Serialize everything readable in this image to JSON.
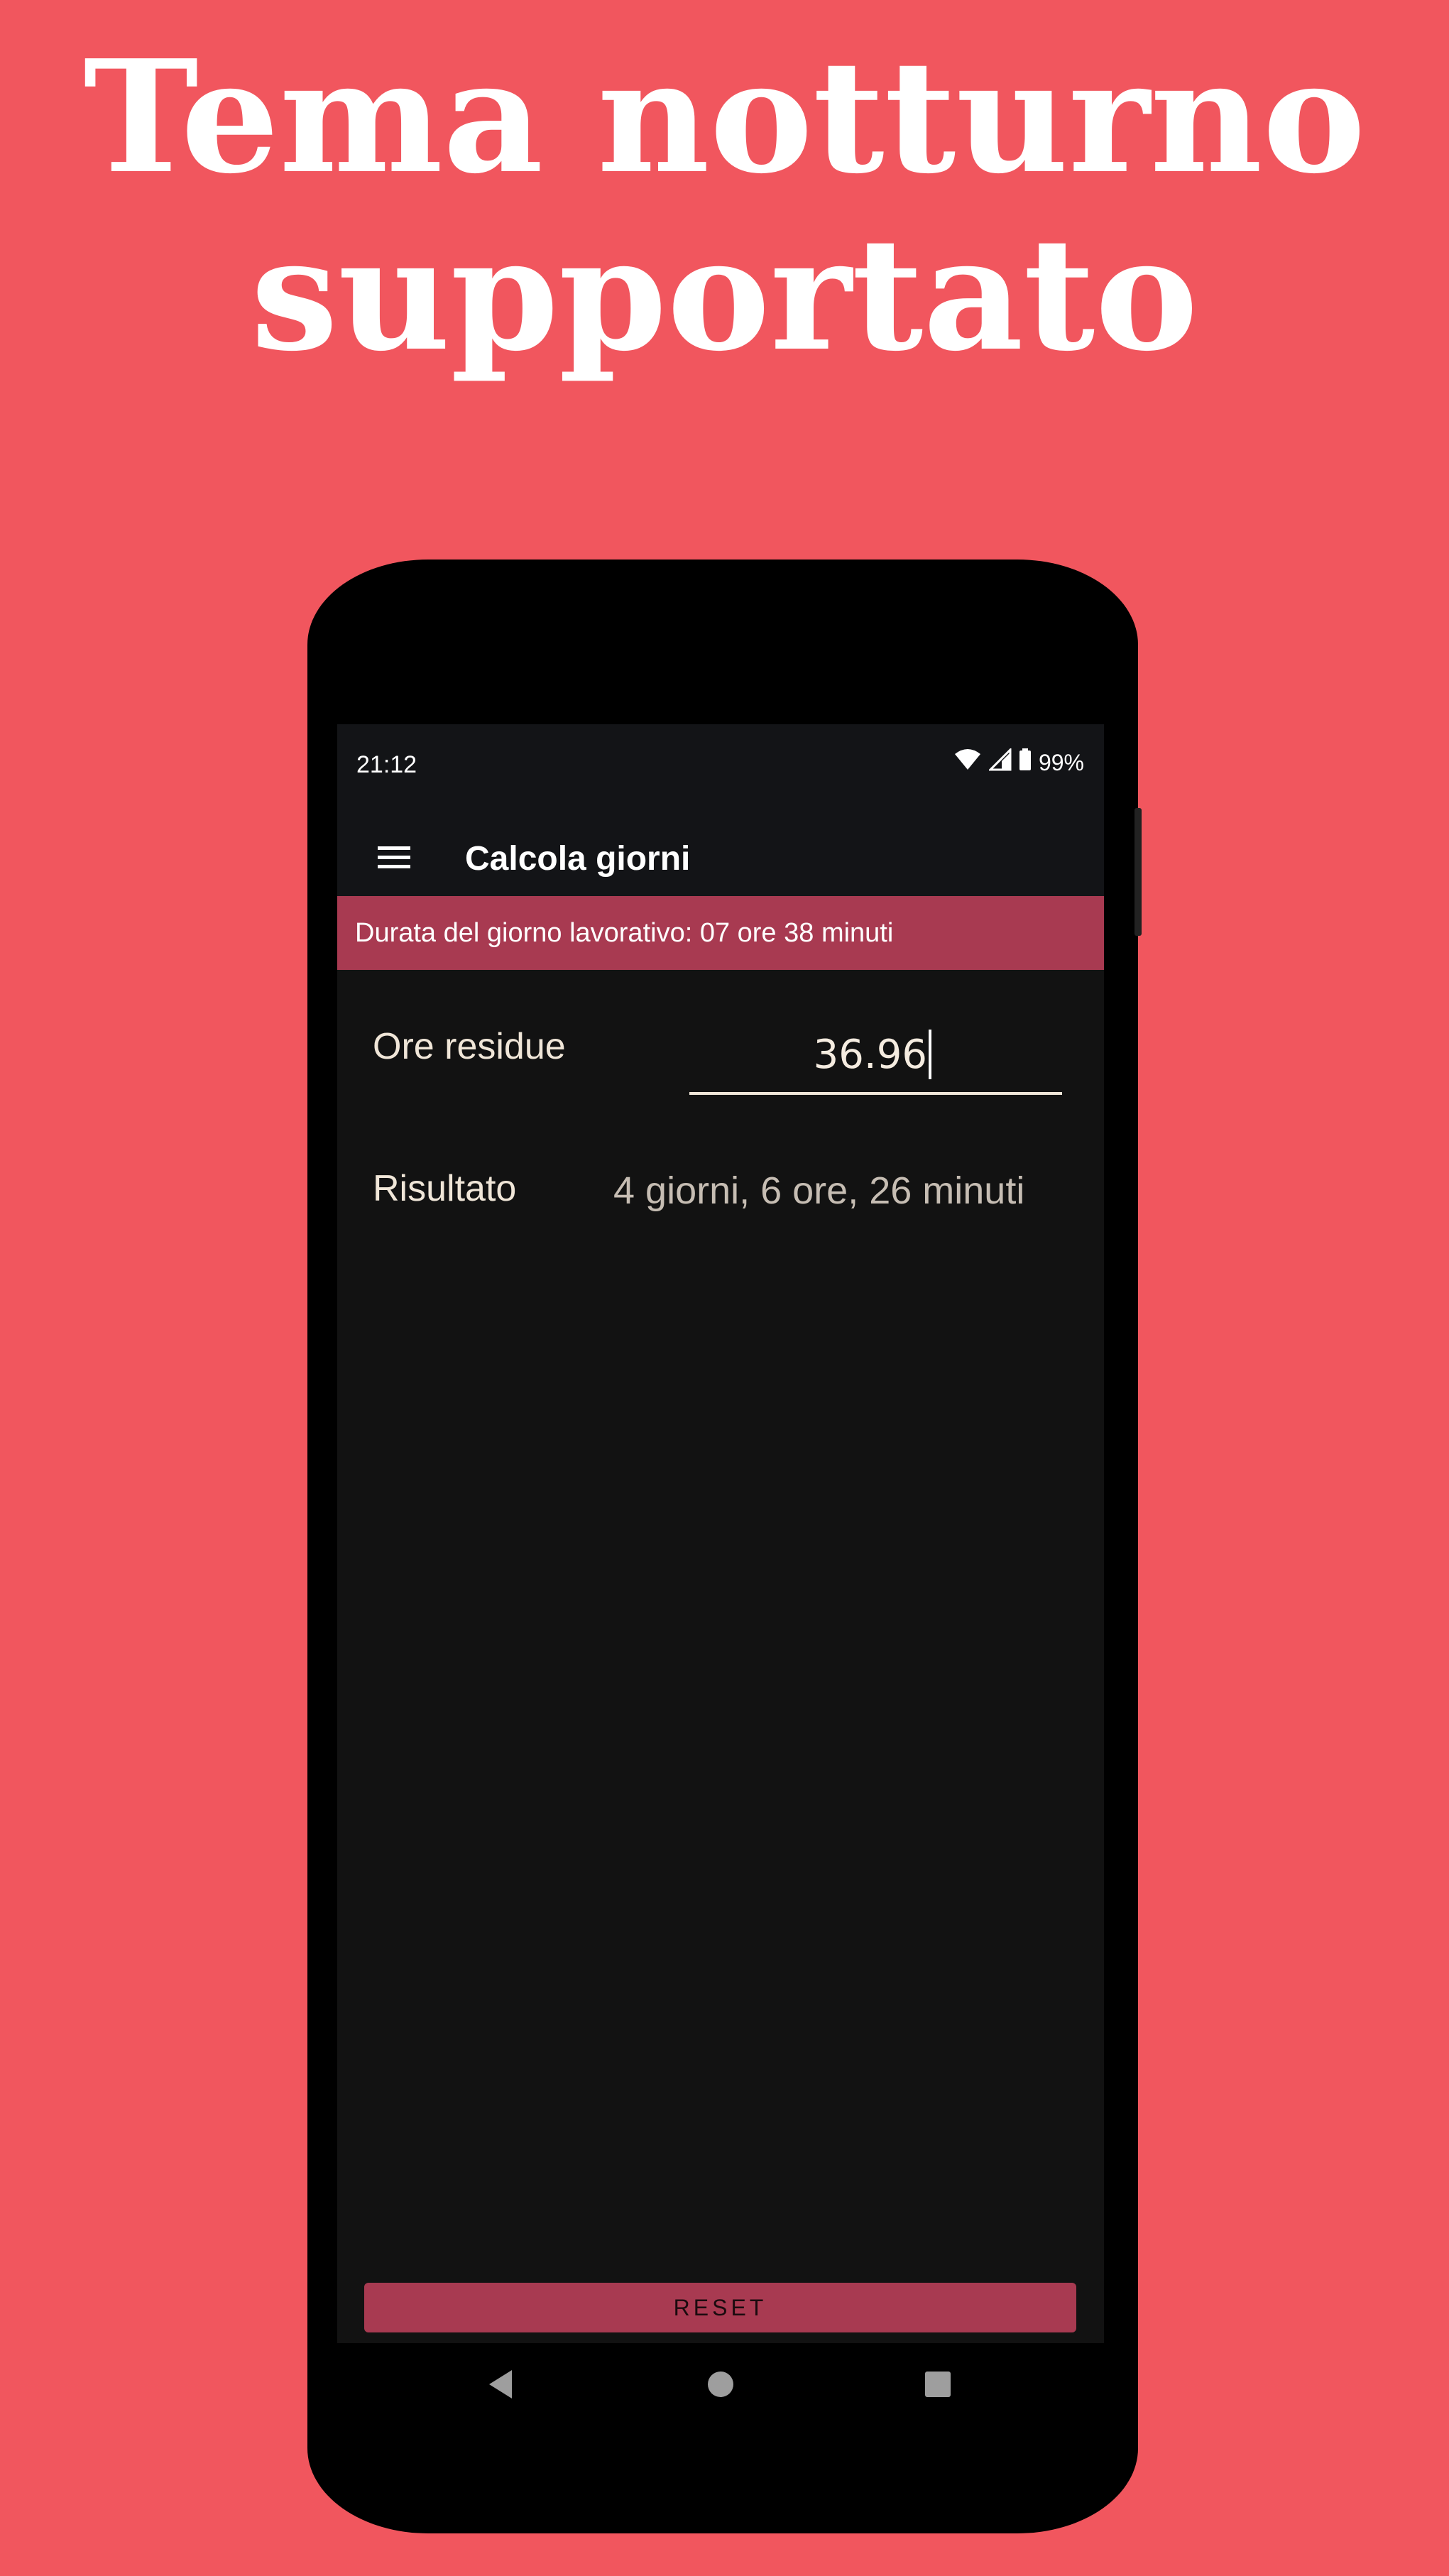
{
  "promo": {
    "headline_line1": "Tema notturno",
    "headline_line2": "supportato",
    "background_color": "#f1565e"
  },
  "status_bar": {
    "time": "21:12",
    "battery": "99%",
    "icons": [
      "wifi-icon",
      "signal-icon",
      "battery-icon"
    ]
  },
  "app_bar": {
    "menu_icon": "hamburger-menu-icon",
    "title": "Calcola giorni"
  },
  "banner": {
    "text": "Durata del giorno lavorativo: 07 ore 38 minuti",
    "color": "#a83a51"
  },
  "form": {
    "hours_label": "Ore residue",
    "hours_value": "36.96",
    "result_label": "Risultato",
    "result_value": "4 giorni, 6 ore, 26 minuti"
  },
  "actions": {
    "reset_label": "RESET"
  },
  "nav_bar": {
    "icons": [
      "back-icon",
      "home-icon",
      "recents-icon"
    ]
  },
  "colors": {
    "screen_bg": "#121212",
    "accent": "#a83a51"
  }
}
